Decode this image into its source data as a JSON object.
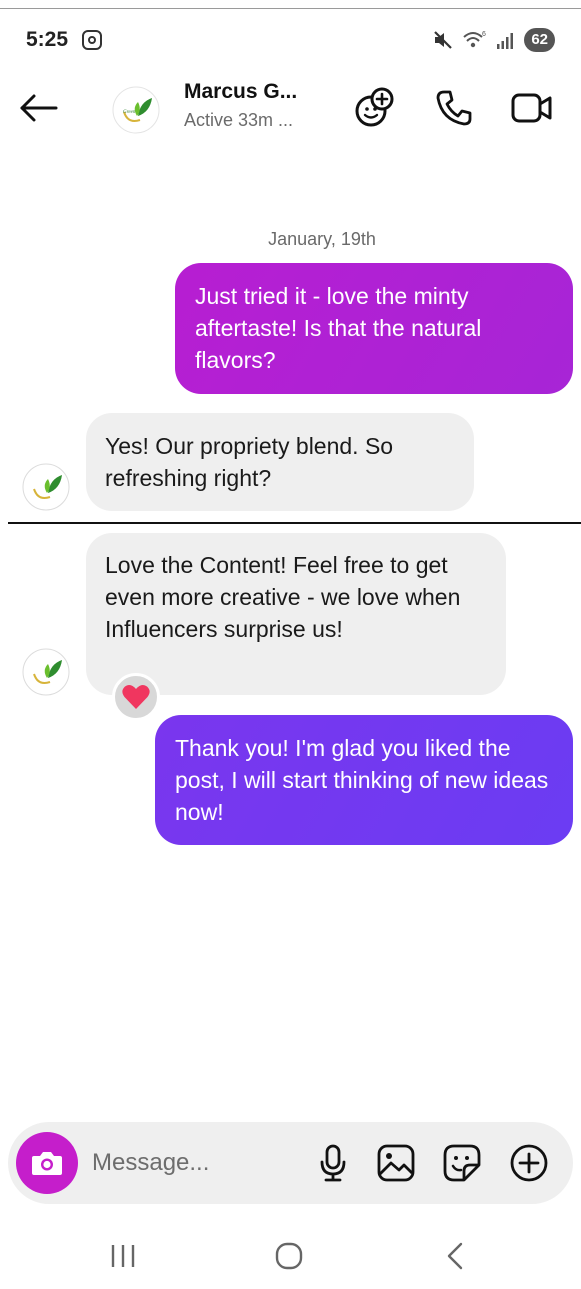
{
  "status_bar": {
    "time": "5:25",
    "battery": "62"
  },
  "header": {
    "contact_name": "Marcus G...",
    "contact_status": "Active 33m ..."
  },
  "conversation": {
    "date_separator": "January, 19th",
    "messages": [
      {
        "direction": "outgoing",
        "text": "Just tried it - love the minty aftertaste! Is that the natural flavors?"
      },
      {
        "direction": "incoming",
        "text": "Yes! Our propriety blend. So refreshing right?"
      },
      {
        "direction": "incoming",
        "text": "Love the Content! Feel free to get even more creative - we love when Influencers surprise us!",
        "reaction": "heart"
      },
      {
        "direction": "outgoing",
        "text": "Thank you! I'm glad you liked the post, I will start thinking of new ideas now!"
      }
    ]
  },
  "composer": {
    "placeholder": "Message..."
  },
  "colors": {
    "outgoing_bubble_1": "#b41fd0",
    "outgoing_bubble_2": "#6a3cf3",
    "incoming_bubble": "#efefef",
    "camera_button": "#c51ecb",
    "reaction_heart": "#f0365f"
  },
  "icons": {
    "header": [
      "back-arrow-icon",
      "add-effect-icon",
      "phone-icon",
      "video-camera-icon"
    ],
    "composer": [
      "camera-icon",
      "microphone-icon",
      "gallery-icon",
      "sticker-icon",
      "add-icon"
    ],
    "navbar": [
      "recent-apps-icon",
      "home-icon",
      "back-icon"
    ]
  }
}
